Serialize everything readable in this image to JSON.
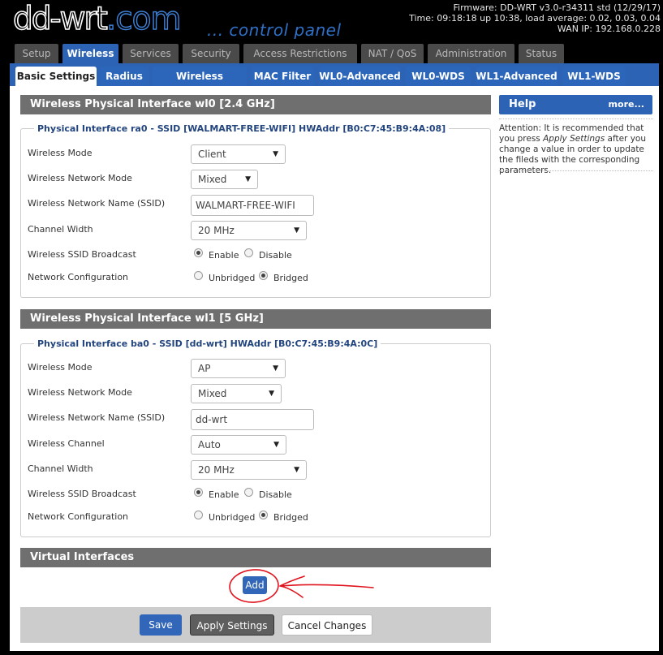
{
  "header": {
    "logo_main": "dd-wrt",
    "logo_dotcom": ".com",
    "subtitle": "... control panel",
    "firmware": "Firmware: DD-WRT v3.0-r34311 std (12/29/17)",
    "time": "Time: 09:18:18 up 10:38, load average: 0.02, 0.03, 0.04",
    "wan": "WAN IP: 192.168.0.228"
  },
  "main_tabs": [
    "Setup",
    "Wireless",
    "Services",
    "Security",
    "Access Restrictions",
    "NAT / QoS",
    "Administration",
    "Status"
  ],
  "sub_tabs": [
    "Basic Settings",
    "Radius",
    "Wireless Security",
    "MAC Filter",
    "WL0-Advanced",
    "WL0-WDS",
    "WL1-Advanced",
    "WL1-WDS"
  ],
  "wl0": {
    "title": "Wireless Physical Interface wl0 [2.4 GHz]",
    "legend": "Physical Interface ra0 - SSID [WALMART-FREE-WIFI] HWAddr [B0:C7:45:B9:4A:08]",
    "mode_label": "Wireless Mode",
    "mode": "Client",
    "netmode_label": "Wireless Network Mode",
    "netmode": "Mixed",
    "ssid_label": "Wireless Network Name (SSID)",
    "ssid": "WALMART-FREE-WIFI",
    "width_label": "Channel Width",
    "width": "20 MHz",
    "broadcast_label": "Wireless SSID Broadcast",
    "enable": "Enable",
    "disable": "Disable",
    "netconfig_label": "Network Configuration",
    "unbridged": "Unbridged",
    "bridged": "Bridged"
  },
  "wl1": {
    "title": "Wireless Physical Interface wl1 [5 GHz]",
    "legend": "Physical Interface ba0 - SSID [dd-wrt] HWAddr [B0:C7:45:B9:4A:0C]",
    "mode_label": "Wireless Mode",
    "mode": "AP",
    "netmode_label": "Wireless Network Mode",
    "netmode": "Mixed",
    "ssid_label": "Wireless Network Name (SSID)",
    "ssid": "dd-wrt",
    "channel_label": "Wireless Channel",
    "channel": "Auto",
    "width_label": "Channel Width",
    "width": "20 MHz",
    "broadcast_label": "Wireless SSID Broadcast",
    "enable": "Enable",
    "disable": "Disable",
    "netconfig_label": "Network Configuration",
    "unbridged": "Unbridged",
    "bridged": "Bridged"
  },
  "virtual": {
    "title": "Virtual Interfaces",
    "add": "Add"
  },
  "help": {
    "title": "Help",
    "more": "more...",
    "text_pre": "Attention: It is recommended that you press ",
    "text_em": "Apply Settings",
    "text_post": " after you change a value in order to update the fileds with the corresponding parameters."
  },
  "footer": {
    "save": "Save",
    "apply": "Apply Settings",
    "cancel": "Cancel Changes"
  },
  "colors": {
    "accent": "#2d63b4",
    "annotation": "#e0141e",
    "section_header": "#6f6f6f"
  }
}
